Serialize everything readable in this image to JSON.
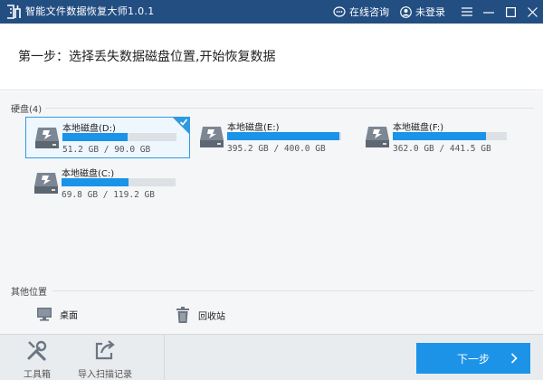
{
  "window": {
    "title": "智能文件数据恢复大师1.0.1",
    "online_consult": "在线咨询",
    "login_status": "未登录"
  },
  "step": {
    "title": "第一步：选择丢失数据磁盘位置,开始恢复数据"
  },
  "disks_section": {
    "label": "硬盘(4)",
    "disks": [
      {
        "name": "本地磁盘(D:)",
        "size": "51.2 GB / 90.0 GB",
        "used_fraction": 0.569,
        "selected": true
      },
      {
        "name": "本地磁盘(E:)",
        "size": "395.2 GB / 400.0 GB",
        "used_fraction": 0.988,
        "selected": false
      },
      {
        "name": "本地磁盘(F:)",
        "size": "362.0 GB / 441.5 GB",
        "used_fraction": 0.82,
        "selected": false
      },
      {
        "name": "本地磁盘(C:)",
        "size": "69.8 GB / 119.2 GB",
        "used_fraction": 0.586,
        "selected": false
      }
    ]
  },
  "other_section": {
    "label": "其他位置",
    "desktop": "桌面",
    "recycle_bin": "回收站"
  },
  "footer": {
    "toolbox": "工具箱",
    "import_scan": "导入扫描记录",
    "next": "下一步"
  },
  "colors": {
    "titlebar": "#234e82",
    "accent": "#1d93e8",
    "bar_bg": "#dde1e5"
  }
}
